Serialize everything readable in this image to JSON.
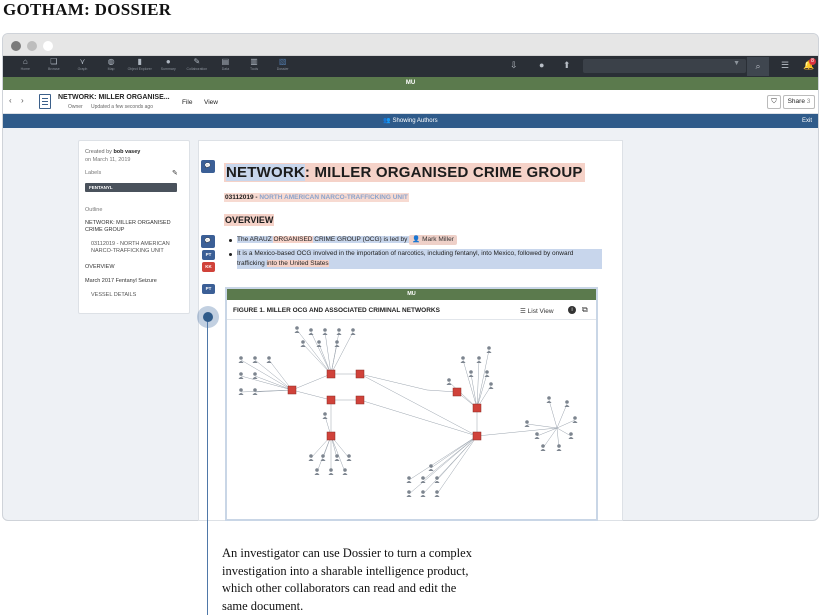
{
  "page_title": "GOTHAM: DOSSIER",
  "appbar": {
    "nav": [
      {
        "icon": "home-icon",
        "glyph": "⌂",
        "label": "Home"
      },
      {
        "icon": "browse-icon",
        "glyph": "❏",
        "label": "Browse"
      },
      {
        "icon": "graph-icon",
        "glyph": "⋎",
        "label": "Graph"
      },
      {
        "icon": "map-icon",
        "glyph": "◍",
        "label": "Map"
      },
      {
        "icon": "object-explorer-icon",
        "glyph": "▮",
        "label": "Object Explorer"
      },
      {
        "icon": "summary-icon",
        "glyph": "●",
        "label": "Summary"
      },
      {
        "icon": "collaboration-icon",
        "glyph": "✎",
        "label": "Collaboration"
      },
      {
        "icon": "data-icon",
        "glyph": "▤",
        "label": "Data"
      },
      {
        "icon": "tools-icon",
        "glyph": "▥",
        "label": "Tools"
      },
      {
        "icon": "dossier-icon",
        "glyph": "▧",
        "label": "Dossier"
      }
    ],
    "notification_count": "8"
  },
  "classification": "MU",
  "docbar": {
    "back": "‹",
    "forward": "›",
    "title": "NETWORK: MILLER ORGANISE...",
    "owner": "Owner",
    "updated": "Updated a few seconds ago",
    "menu": [
      "File",
      "View"
    ],
    "shield": "⛉",
    "share_label": "Share",
    "share_count": "3"
  },
  "authorsbar": {
    "label": "Showing Authors",
    "exit": "Exit"
  },
  "sidebar": {
    "created_prefix": "Created by",
    "created_by": "bob vasey",
    "date": "on March 11, 2019",
    "labels_title": "Labels",
    "tag": "FENTANYL",
    "outline_title": "Outline",
    "outline": [
      "NETWORK: MILLER ORGANISED CRIME GROUP",
      "03112019 - NORTH AMERICAN NARCO-TRAFFICKING UNIT",
      "OVERVIEW",
      "March 2017 Fentanyl Seizure",
      "VESSEL DETAILS"
    ]
  },
  "doc": {
    "title_part1": "NETWORK",
    "title_part2": ": MILLER ORGANISED CRIME GROUP",
    "date_code": "03112019 -",
    "unit": "NORTH AMERICAN NARCO-TRAFFICKING UNIT",
    "overview": "OVERVIEW",
    "b1_pre": "The ARAUZ ",
    "b1_org": "ORGANISED",
    "b1_mid": " CRIME GROUP (OCG) is led by ",
    "b1_person": "Mark Miller",
    "b2_main": "It is a Mexico-based OCG involved in the importation of narcotics, including fentanyl, into Mexico, followed by onward trafficking ",
    "b2_end": "into the United States",
    "badges": [
      "PT",
      "KK",
      "PT"
    ],
    "comment_glyph": "💬"
  },
  "figure": {
    "classification": "MU",
    "title": "FIGURE 1. MILLER OCG AND ASSOCIATED CRIMINAL NETWORKS",
    "list_view": "List View",
    "info_glyph": "i",
    "external_glyph": "⧉"
  },
  "caption": "An investigator can use Dossier to turn a complex investigation into a sharable intelligence product, which other collaborators can read and edit the same document.",
  "colors": {
    "accent": "#2f5b8a",
    "classification_green": "#5b7a4d",
    "highlight_pink": "#f5d2c8",
    "highlight_blue": "#c8d6ec",
    "node_red": "#d0423a"
  }
}
